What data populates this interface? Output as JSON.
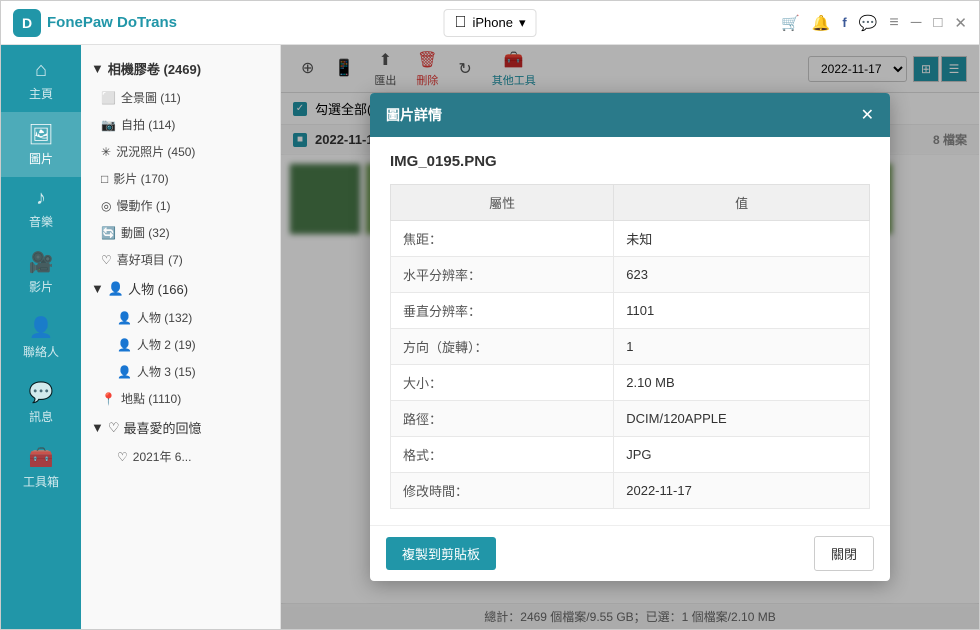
{
  "app": {
    "name": "FonePaw DoTrans",
    "logo_letter": "D"
  },
  "titlebar": {
    "device_name": "iPhone",
    "device_icon": "",
    "dropdown_arrow": "▾",
    "actions": {
      "cart": "🛒",
      "bell": "🔔",
      "facebook": "f",
      "chat": "💬",
      "menu": "≡",
      "minimize": "─",
      "maximize": "□",
      "close": "✕"
    }
  },
  "sidebar": {
    "items": [
      {
        "id": "home",
        "icon": "⌂",
        "label": "主頁"
      },
      {
        "id": "photos",
        "icon": "🖼",
        "label": "圖片"
      },
      {
        "id": "music",
        "icon": "♪",
        "label": "音樂"
      },
      {
        "id": "videos",
        "icon": "🎥",
        "label": "影片"
      },
      {
        "id": "contacts",
        "icon": "👤",
        "label": "聯絡人"
      },
      {
        "id": "messages",
        "icon": "💬",
        "label": "訊息"
      },
      {
        "id": "toolbox",
        "icon": "🧰",
        "label": "工具箱"
      }
    ],
    "active_item": "photos"
  },
  "file_tree": {
    "root": {
      "label": "相機膠卷",
      "count": 2469
    },
    "items": [
      {
        "id": "panorama",
        "icon": "⬜",
        "label": "全景圖",
        "count": 11
      },
      {
        "id": "selfie",
        "icon": "📷",
        "label": "自拍",
        "count": 114
      },
      {
        "id": "live",
        "icon": "✳",
        "label": "況況照片",
        "count": 450
      },
      {
        "id": "video",
        "icon": "□",
        "label": "影片",
        "count": 170
      },
      {
        "id": "slowmo",
        "icon": "◎",
        "label": "慢動作",
        "count": 1
      },
      {
        "id": "animation",
        "icon": "🔄",
        "label": "動圖",
        "count": 32
      },
      {
        "id": "favorites",
        "icon": "♡",
        "label": "喜好項目",
        "count": 7
      }
    ],
    "people": {
      "label": "人物",
      "count": 166,
      "sub": [
        {
          "id": "people1",
          "label": "人物",
          "count": 132
        },
        {
          "id": "people2",
          "label": "人物 2",
          "count": 19
        },
        {
          "id": "people3",
          "label": "人物 3",
          "count": 15
        }
      ]
    },
    "places": {
      "label": "地點",
      "count": 1110
    },
    "memories": {
      "label": "最喜愛的回憶",
      "sub_label": "2021年 6..."
    }
  },
  "toolbar": {
    "add_label": "新增",
    "export_label": "匯出",
    "delete_label": "刪除",
    "other_label": "其他工具",
    "date_value": "2022-11-17",
    "date_placeholder": "2022-11-17 ▾"
  },
  "content": {
    "select_all_label": "勾選全部(2469)",
    "date_group": "2022-11-17",
    "file_count": "8 檔案"
  },
  "status_bar": {
    "text": "總計：2469 個檔案/9.55 GB；已選：1 個檔案/2.10 MB"
  },
  "modal": {
    "title": "圖片詳情",
    "filename": "IMG_0195.PNG",
    "table_headers": [
      "屬性",
      "值"
    ],
    "rows": [
      {
        "prop": "焦距：",
        "val": "未知"
      },
      {
        "prop": "水平分辨率：",
        "val": "623"
      },
      {
        "prop": "垂直分辨率：",
        "val": "1101"
      },
      {
        "prop": "方向（旋轉）：",
        "val": "1"
      },
      {
        "prop": "大小：",
        "val": "2.10 MB"
      },
      {
        "prop": "路徑：",
        "val": "DCIM/120APPLE"
      },
      {
        "prop": "格式：",
        "val": "JPG"
      },
      {
        "prop": "修改時間：",
        "val": "2022-11-17"
      }
    ],
    "copy_btn": "複製到剪貼板",
    "close_btn": "關閉"
  }
}
